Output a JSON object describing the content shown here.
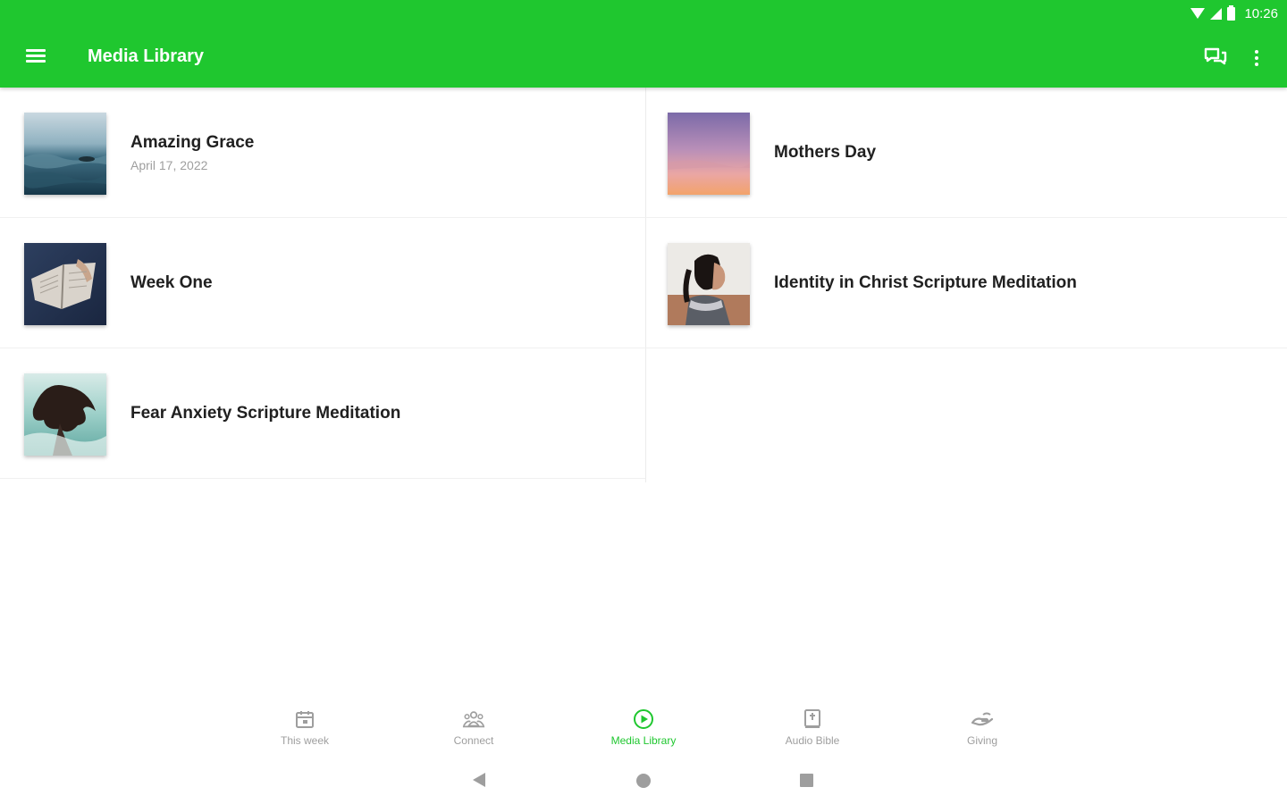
{
  "status_bar": {
    "time": "10:26"
  },
  "app_bar": {
    "title": "Media Library",
    "icons": [
      "menu-icon",
      "chat-icon",
      "more-vert-icon"
    ],
    "color": "#1fc72f"
  },
  "media_items": [
    {
      "title": "Amazing Grace",
      "date": "April 17, 2022",
      "thumbnail": "ocean-waves"
    },
    {
      "title": "Mothers Day",
      "date": "",
      "thumbnail": "sunset-sky"
    },
    {
      "title": "Week One",
      "date": "",
      "thumbnail": "open-bible"
    },
    {
      "title": "Identity in Christ Scripture Meditation",
      "date": "",
      "thumbnail": "woman-profile"
    },
    {
      "title": "Fear Anxiety Scripture Meditation",
      "date": "",
      "thumbnail": "hair-in-water"
    }
  ],
  "bottom_nav": {
    "items": [
      {
        "label": "This week",
        "icon": "calendar-icon",
        "active": false
      },
      {
        "label": "Connect",
        "icon": "group-icon",
        "active": false
      },
      {
        "label": "Media Library",
        "icon": "play-circle-icon",
        "active": true
      },
      {
        "label": "Audio Bible",
        "icon": "bible-icon",
        "active": false
      },
      {
        "label": "Giving",
        "icon": "giving-hand-icon",
        "active": false
      }
    ],
    "active_color": "#1fc72f"
  },
  "system_nav": {
    "icons": [
      "back-icon",
      "home-icon",
      "recents-icon"
    ]
  }
}
